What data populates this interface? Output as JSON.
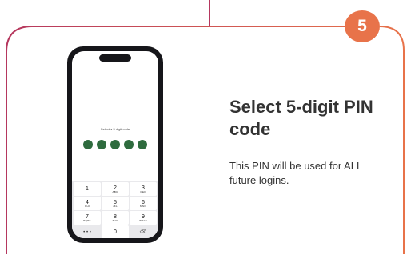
{
  "step": {
    "number": "5"
  },
  "phone": {
    "prompt": "Select a 5-digit code",
    "pin_length": 5,
    "pin_filled": 5,
    "keypad": [
      {
        "digit": "1",
        "letters": ""
      },
      {
        "digit": "2",
        "letters": "ABC"
      },
      {
        "digit": "3",
        "letters": "DEF"
      },
      {
        "digit": "4",
        "letters": "GHI"
      },
      {
        "digit": "5",
        "letters": "JKL"
      },
      {
        "digit": "6",
        "letters": "MNO"
      },
      {
        "digit": "7",
        "letters": "PQRS"
      },
      {
        "digit": "8",
        "letters": "TUV"
      },
      {
        "digit": "9",
        "letters": "WXYZ"
      },
      {
        "digit": "• • •",
        "letters": ""
      },
      {
        "digit": "0",
        "letters": ""
      },
      {
        "digit": "⌫",
        "letters": ""
      }
    ]
  },
  "content": {
    "title": "Select 5-digit PIN code",
    "description": "This PIN will be used for ALL future logins."
  },
  "colors": {
    "frame_gradient_start": "#b5375e",
    "frame_gradient_end": "#e8734a",
    "badge": "#e8734a",
    "pin_dot": "#2e6b3e",
    "text": "#333333"
  }
}
